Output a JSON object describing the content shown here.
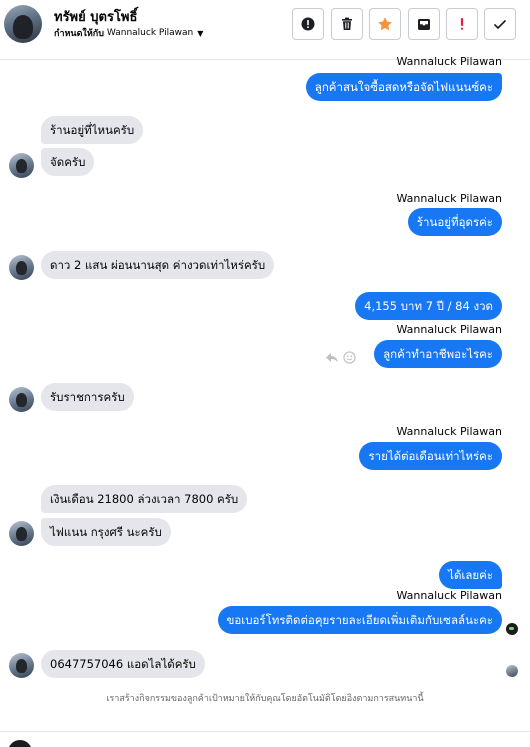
{
  "header": {
    "contact_name": "ทรัพย์ บุตรโพธิ์",
    "assign_label": "กำหนดให้กับ",
    "assignee": "Wannaluck Pilawan",
    "actions": [
      {
        "name": "mark-spam",
        "icon": "exclamation-circle-icon"
      },
      {
        "name": "delete",
        "icon": "trash-icon"
      },
      {
        "name": "star",
        "icon": "star-icon",
        "color": "#f7923a"
      },
      {
        "name": "move-to-inbox",
        "icon": "archive-icon"
      },
      {
        "name": "follow-up",
        "icon": "exclamation-icon",
        "color": "#e41e3f"
      },
      {
        "name": "mark-done",
        "icon": "check-icon"
      }
    ]
  },
  "conversation": {
    "sender_name": "Wannaluck Pilawan",
    "messages": [
      {
        "dir": "out",
        "text": "ลูกค้าสนใจซื้อสดหรือจัดไฟแนนซ์คะ"
      },
      {
        "dir": "in",
        "text": "ร้านอยู่ที่ไหนครับ"
      },
      {
        "dir": "in",
        "text": "จัดครับ"
      },
      {
        "dir": "out",
        "text": "ร้านอยู่ที่อุดรค่ะ"
      },
      {
        "dir": "in",
        "text": "ดาว 2 แสน ผ่อนนานสุด ค่างวดเท่าไหร่ครับ"
      },
      {
        "dir": "out",
        "text": "4,155 บาท  7 ปี / 84 งวด"
      },
      {
        "dir": "out",
        "text": "ลูกค้าทำอาชีพอะไรคะ"
      },
      {
        "dir": "in",
        "text": "รับราชการครับ"
      },
      {
        "dir": "out",
        "text": "รายได้ต่อเดือนเท่าไหร่คะ"
      },
      {
        "dir": "in",
        "text": "เงินเดือน 21800 ล่วงเวลา 7800 ครับ"
      },
      {
        "dir": "in",
        "text": "ไฟแนน กรุงศรี นะครับ"
      },
      {
        "dir": "out",
        "text": "ได้เลยค่ะ"
      },
      {
        "dir": "out",
        "text": "ขอเบอร์โทรติดต่อคุยรายละเอียดเพิ่มเติมกับเซลล์นะคะ"
      },
      {
        "dir": "in",
        "text": "0647757046 แอดไลได้ครับ"
      }
    ],
    "hover_icons": [
      "reply-icon",
      "smiley-icon"
    ]
  },
  "footer": {
    "note": "เราสร้างกิจกรรมของลูกค้าเป้าหมายให้กับคุณโดยอัตโนมัติโดยอิงตามการสนทนานี้"
  },
  "colors": {
    "outgoing_bubble": "#1877f2",
    "incoming_bubble": "#e4e6eb",
    "star": "#f7923a",
    "alert": "#e41e3f"
  }
}
